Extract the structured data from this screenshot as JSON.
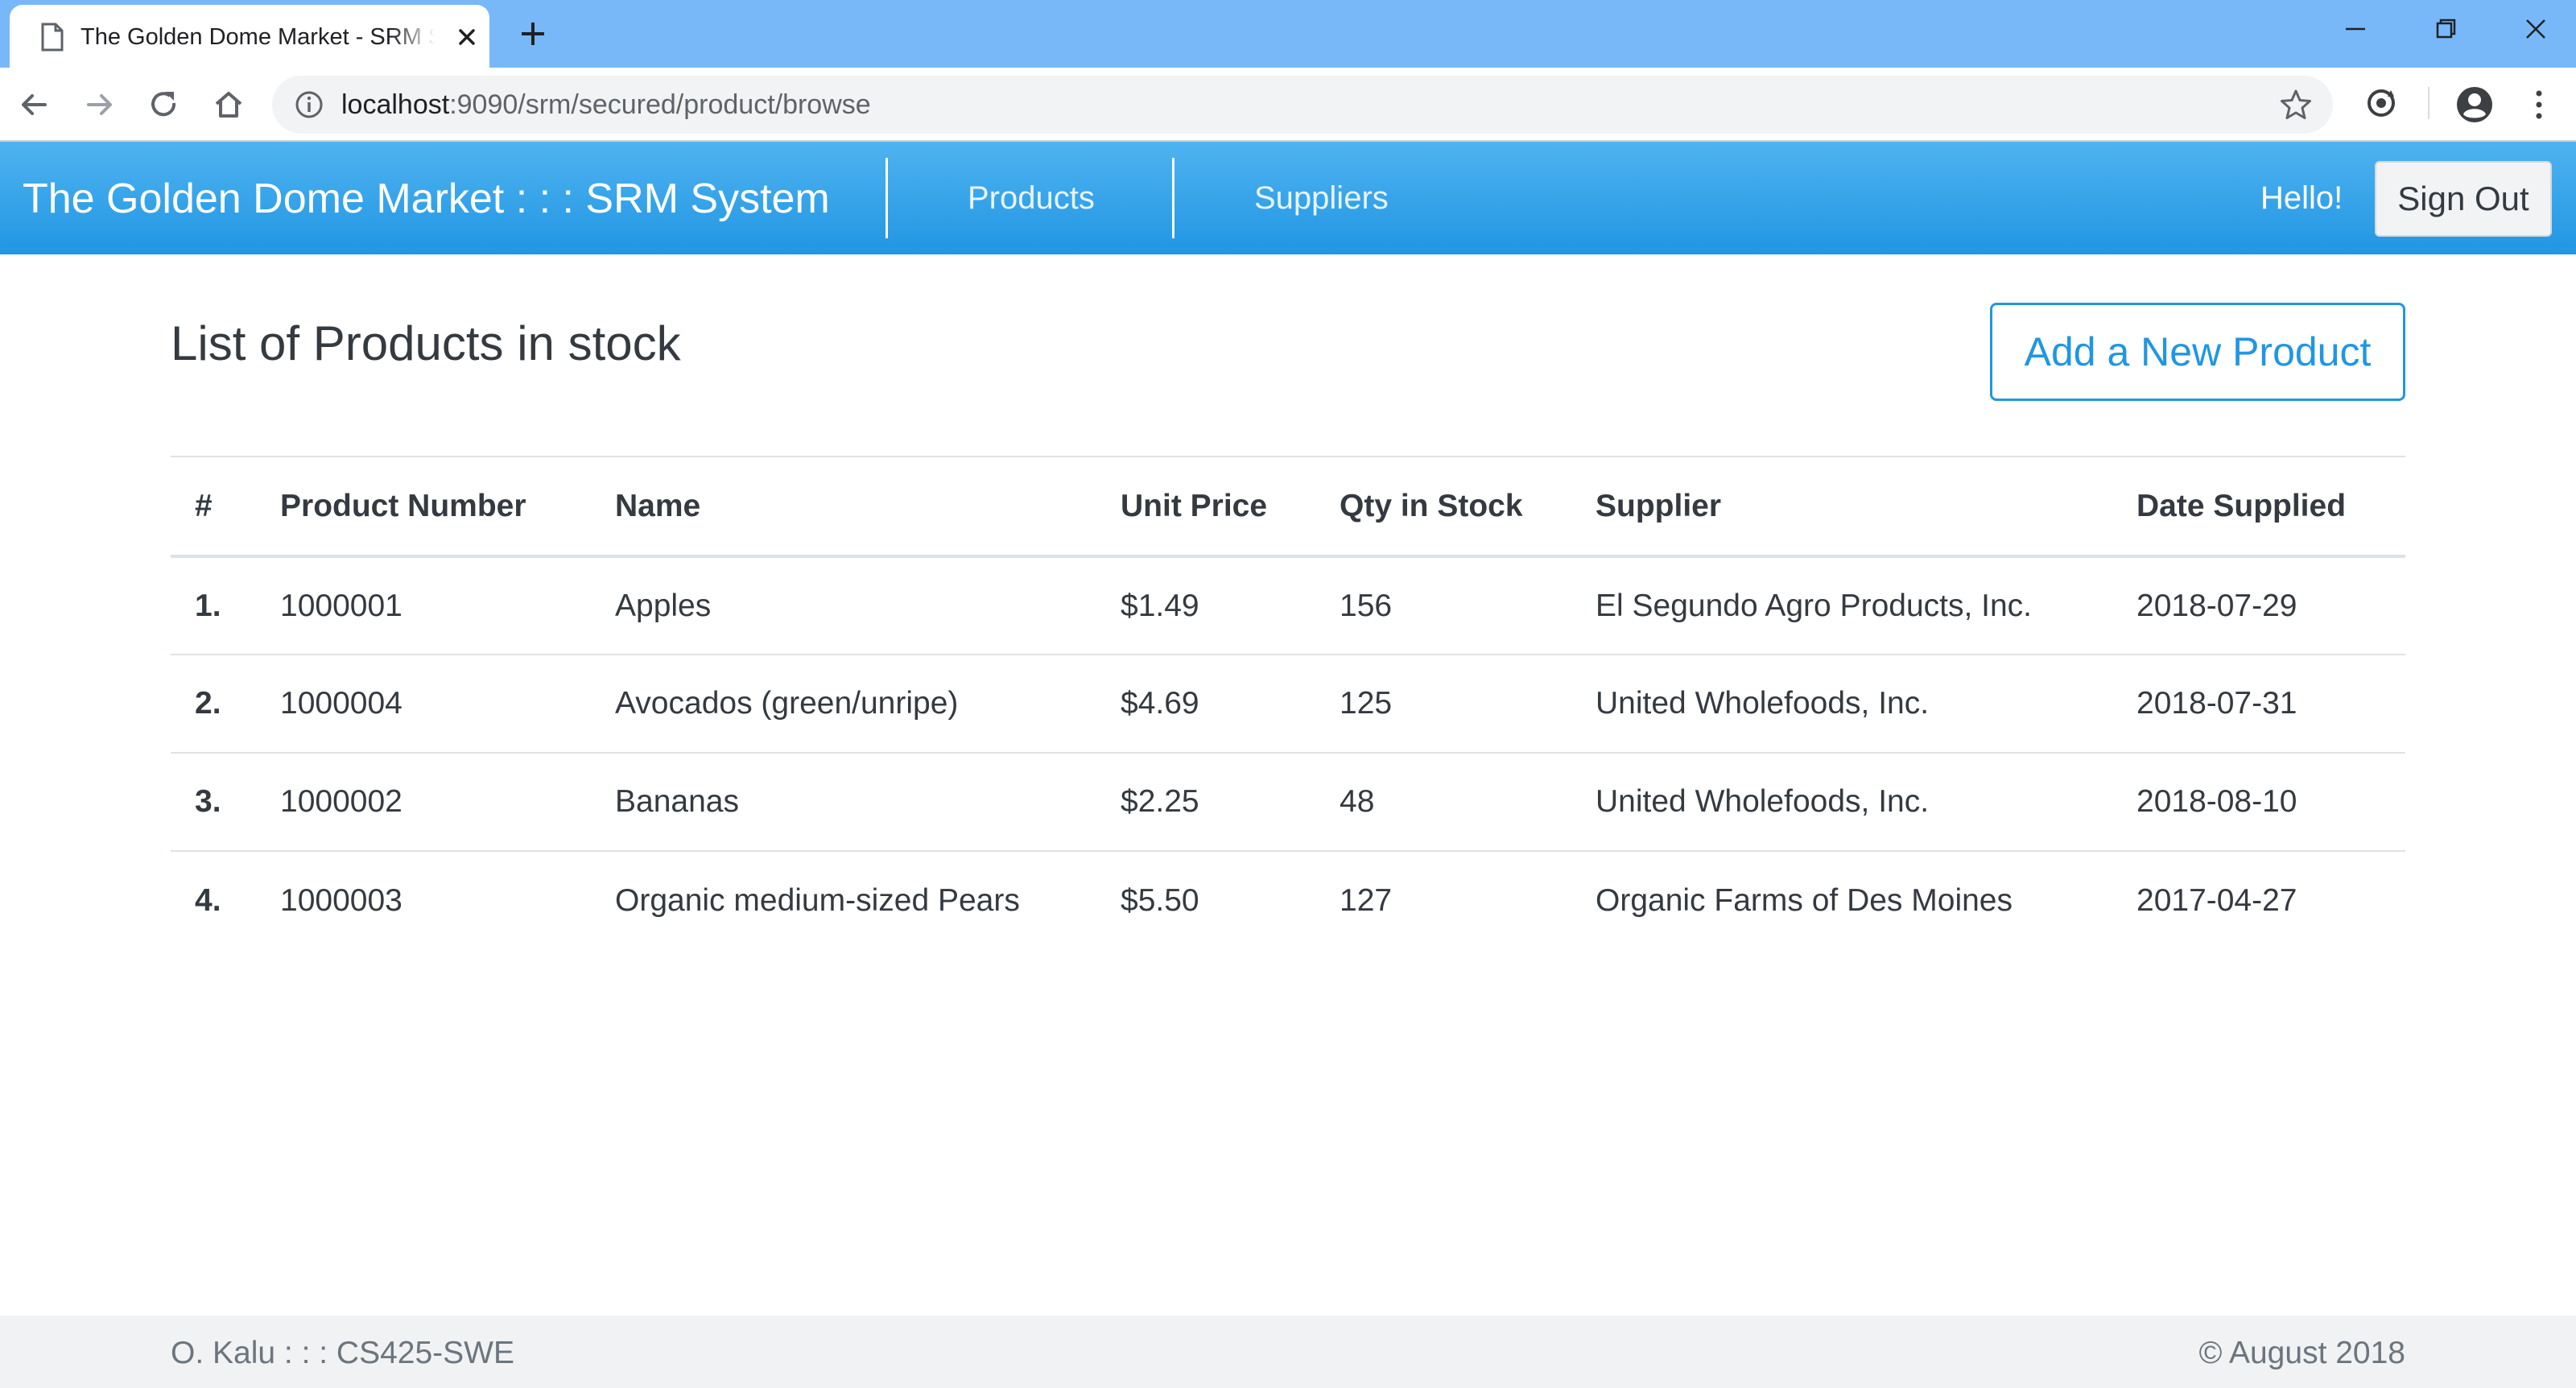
{
  "browser": {
    "tab_title": "The Golden Dome Market - SRM System",
    "url_host": "localhost",
    "url_rest": ":9090/srm/secured/product/browse"
  },
  "navbar": {
    "brand": "The Golden Dome Market : : : SRM System",
    "links": [
      "Products",
      "Suppliers"
    ],
    "greeting": "Hello!",
    "signout_label": "Sign Out",
    "accent_color": "#2196e3"
  },
  "main": {
    "title": "List of Products in stock",
    "add_button_label": "Add a New Product",
    "table": {
      "headers": [
        "#",
        "Product Number",
        "Name",
        "Unit Price",
        "Qty in Stock",
        "Supplier",
        "Date Supplied"
      ],
      "rows": [
        [
          "1.",
          "1000001",
          "Apples",
          "$1.49",
          "156",
          "El Segundo Agro Products, Inc.",
          "2018-07-29"
        ],
        [
          "2.",
          "1000004",
          "Avocados (green/unripe)",
          "$4.69",
          "125",
          "United Wholefoods, Inc.",
          "2018-07-31"
        ],
        [
          "3.",
          "1000002",
          "Bananas",
          "$2.25",
          "48",
          "United Wholefoods, Inc.",
          "2018-08-10"
        ],
        [
          "4.",
          "1000003",
          "Organic medium-sized Pears",
          "$5.50",
          "127",
          "Organic Farms of Des Moines",
          "2017-04-27"
        ]
      ]
    }
  },
  "footer": {
    "left": "O. Kalu : : : CS425-SWE",
    "right": "© August 2018"
  }
}
